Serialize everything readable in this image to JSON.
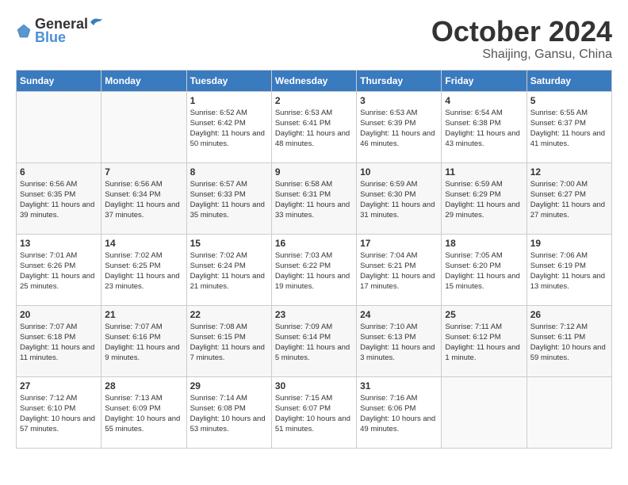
{
  "logo": {
    "text_general": "General",
    "text_blue": "Blue"
  },
  "title": "October 2024",
  "location": "Shaijing, Gansu, China",
  "headers": [
    "Sunday",
    "Monday",
    "Tuesday",
    "Wednesday",
    "Thursday",
    "Friday",
    "Saturday"
  ],
  "weeks": [
    [
      {
        "day": "",
        "info": ""
      },
      {
        "day": "",
        "info": ""
      },
      {
        "day": "1",
        "info": "Sunrise: 6:52 AM\nSunset: 6:42 PM\nDaylight: 11 hours and 50 minutes."
      },
      {
        "day": "2",
        "info": "Sunrise: 6:53 AM\nSunset: 6:41 PM\nDaylight: 11 hours and 48 minutes."
      },
      {
        "day": "3",
        "info": "Sunrise: 6:53 AM\nSunset: 6:39 PM\nDaylight: 11 hours and 46 minutes."
      },
      {
        "day": "4",
        "info": "Sunrise: 6:54 AM\nSunset: 6:38 PM\nDaylight: 11 hours and 43 minutes."
      },
      {
        "day": "5",
        "info": "Sunrise: 6:55 AM\nSunset: 6:37 PM\nDaylight: 11 hours and 41 minutes."
      }
    ],
    [
      {
        "day": "6",
        "info": "Sunrise: 6:56 AM\nSunset: 6:35 PM\nDaylight: 11 hours and 39 minutes."
      },
      {
        "day": "7",
        "info": "Sunrise: 6:56 AM\nSunset: 6:34 PM\nDaylight: 11 hours and 37 minutes."
      },
      {
        "day": "8",
        "info": "Sunrise: 6:57 AM\nSunset: 6:33 PM\nDaylight: 11 hours and 35 minutes."
      },
      {
        "day": "9",
        "info": "Sunrise: 6:58 AM\nSunset: 6:31 PM\nDaylight: 11 hours and 33 minutes."
      },
      {
        "day": "10",
        "info": "Sunrise: 6:59 AM\nSunset: 6:30 PM\nDaylight: 11 hours and 31 minutes."
      },
      {
        "day": "11",
        "info": "Sunrise: 6:59 AM\nSunset: 6:29 PM\nDaylight: 11 hours and 29 minutes."
      },
      {
        "day": "12",
        "info": "Sunrise: 7:00 AM\nSunset: 6:27 PM\nDaylight: 11 hours and 27 minutes."
      }
    ],
    [
      {
        "day": "13",
        "info": "Sunrise: 7:01 AM\nSunset: 6:26 PM\nDaylight: 11 hours and 25 minutes."
      },
      {
        "day": "14",
        "info": "Sunrise: 7:02 AM\nSunset: 6:25 PM\nDaylight: 11 hours and 23 minutes."
      },
      {
        "day": "15",
        "info": "Sunrise: 7:02 AM\nSunset: 6:24 PM\nDaylight: 11 hours and 21 minutes."
      },
      {
        "day": "16",
        "info": "Sunrise: 7:03 AM\nSunset: 6:22 PM\nDaylight: 11 hours and 19 minutes."
      },
      {
        "day": "17",
        "info": "Sunrise: 7:04 AM\nSunset: 6:21 PM\nDaylight: 11 hours and 17 minutes."
      },
      {
        "day": "18",
        "info": "Sunrise: 7:05 AM\nSunset: 6:20 PM\nDaylight: 11 hours and 15 minutes."
      },
      {
        "day": "19",
        "info": "Sunrise: 7:06 AM\nSunset: 6:19 PM\nDaylight: 11 hours and 13 minutes."
      }
    ],
    [
      {
        "day": "20",
        "info": "Sunrise: 7:07 AM\nSunset: 6:18 PM\nDaylight: 11 hours and 11 minutes."
      },
      {
        "day": "21",
        "info": "Sunrise: 7:07 AM\nSunset: 6:16 PM\nDaylight: 11 hours and 9 minutes."
      },
      {
        "day": "22",
        "info": "Sunrise: 7:08 AM\nSunset: 6:15 PM\nDaylight: 11 hours and 7 minutes."
      },
      {
        "day": "23",
        "info": "Sunrise: 7:09 AM\nSunset: 6:14 PM\nDaylight: 11 hours and 5 minutes."
      },
      {
        "day": "24",
        "info": "Sunrise: 7:10 AM\nSunset: 6:13 PM\nDaylight: 11 hours and 3 minutes."
      },
      {
        "day": "25",
        "info": "Sunrise: 7:11 AM\nSunset: 6:12 PM\nDaylight: 11 hours and 1 minute."
      },
      {
        "day": "26",
        "info": "Sunrise: 7:12 AM\nSunset: 6:11 PM\nDaylight: 10 hours and 59 minutes."
      }
    ],
    [
      {
        "day": "27",
        "info": "Sunrise: 7:12 AM\nSunset: 6:10 PM\nDaylight: 10 hours and 57 minutes."
      },
      {
        "day": "28",
        "info": "Sunrise: 7:13 AM\nSunset: 6:09 PM\nDaylight: 10 hours and 55 minutes."
      },
      {
        "day": "29",
        "info": "Sunrise: 7:14 AM\nSunset: 6:08 PM\nDaylight: 10 hours and 53 minutes."
      },
      {
        "day": "30",
        "info": "Sunrise: 7:15 AM\nSunset: 6:07 PM\nDaylight: 10 hours and 51 minutes."
      },
      {
        "day": "31",
        "info": "Sunrise: 7:16 AM\nSunset: 6:06 PM\nDaylight: 10 hours and 49 minutes."
      },
      {
        "day": "",
        "info": ""
      },
      {
        "day": "",
        "info": ""
      }
    ]
  ]
}
